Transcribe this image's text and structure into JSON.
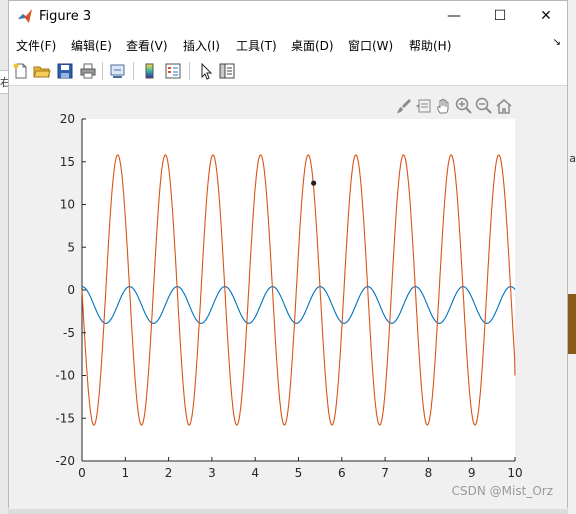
{
  "window": {
    "title": "Figure 3",
    "controls": {
      "minimize": "—",
      "maximize": "☐",
      "close": "✕"
    }
  },
  "menu": {
    "items": [
      "文件(F)",
      "编辑(E)",
      "查看(V)",
      "插入(I)",
      "工具(T)",
      "桌面(D)",
      "窗口(W)",
      "帮助(H)"
    ],
    "overflow": "↘"
  },
  "toolbar": {
    "icons": [
      "new-figure-icon",
      "open-file-icon",
      "save-icon",
      "print-icon",
      "link-icon",
      "colorbar-icon",
      "legend-icon",
      "select-pointer-icon",
      "property-inspector-icon"
    ]
  },
  "axes_toolbar": {
    "icons": [
      "brush-icon",
      "data-tips-icon",
      "pan-icon",
      "zoom-in-icon",
      "zoom-out-icon",
      "home-icon"
    ]
  },
  "background": {
    "left_text": "右",
    "right_text": "a"
  },
  "watermark": "CSDN @Mist_Orz",
  "chart_data": {
    "type": "line",
    "title": "",
    "xlabel": "",
    "ylabel": "",
    "xlim": [
      0,
      10
    ],
    "ylim": [
      -20,
      20
    ],
    "x_ticks": [
      "0",
      "1",
      "2",
      "3",
      "4",
      "5",
      "6",
      "7",
      "8",
      "9",
      "10"
    ],
    "y_ticks": [
      "20",
      "15",
      "10",
      "5",
      "0",
      "-5",
      "-10",
      "-15",
      "-20"
    ],
    "grid": false,
    "colors": {
      "series1": "#0072BD",
      "series2": "#D95319",
      "marker": "#222222"
    },
    "series": [
      {
        "period": 1.1,
        "x": [
          0,
          0.14,
          0.275,
          0.41,
          0.55,
          0.69,
          0.825,
          0.96,
          1.1
        ],
        "values": [
          0.4,
          -0.9,
          -2.1,
          -3.3,
          -3.9,
          -3.3,
          -2.1,
          -0.9,
          0.4
        ],
        "extent": [
          0,
          10
        ]
      },
      {
        "period": 1.1,
        "x": [
          0,
          0.275,
          0.55,
          0.825,
          1.1
        ],
        "values": [
          0,
          -15.8,
          0,
          15.8,
          0
        ],
        "extent": [
          0,
          10
        ],
        "end_value": -10
      }
    ],
    "annotations": [
      {
        "x": 5.35,
        "y": 12.5
      }
    ]
  }
}
